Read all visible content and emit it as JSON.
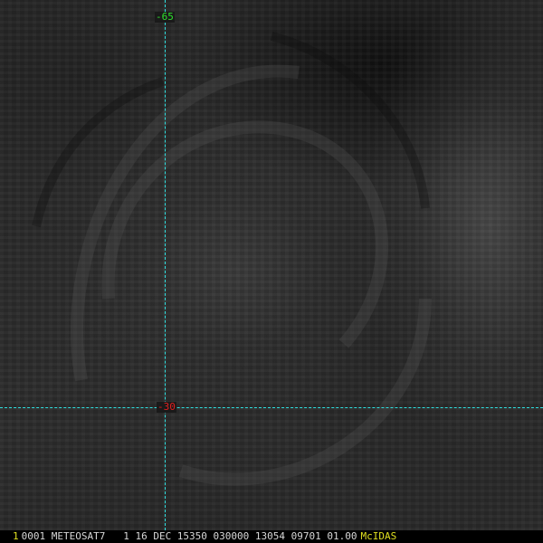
{
  "grid": {
    "longitude_label": "-65",
    "latitude_label": "-30",
    "longitude_label_color": "#2ee02e",
    "latitude_label_color": "#e02020",
    "line_color": "#2ee0e0"
  },
  "status_bar": {
    "frame_number": "1",
    "text": "0001 METEOSAT7   1 16 DEC 15350 030000 13054 09701 01.00",
    "brand": "McIDAS",
    "frame_number_color": "#e0e020",
    "brand_color": "#e0e020"
  }
}
